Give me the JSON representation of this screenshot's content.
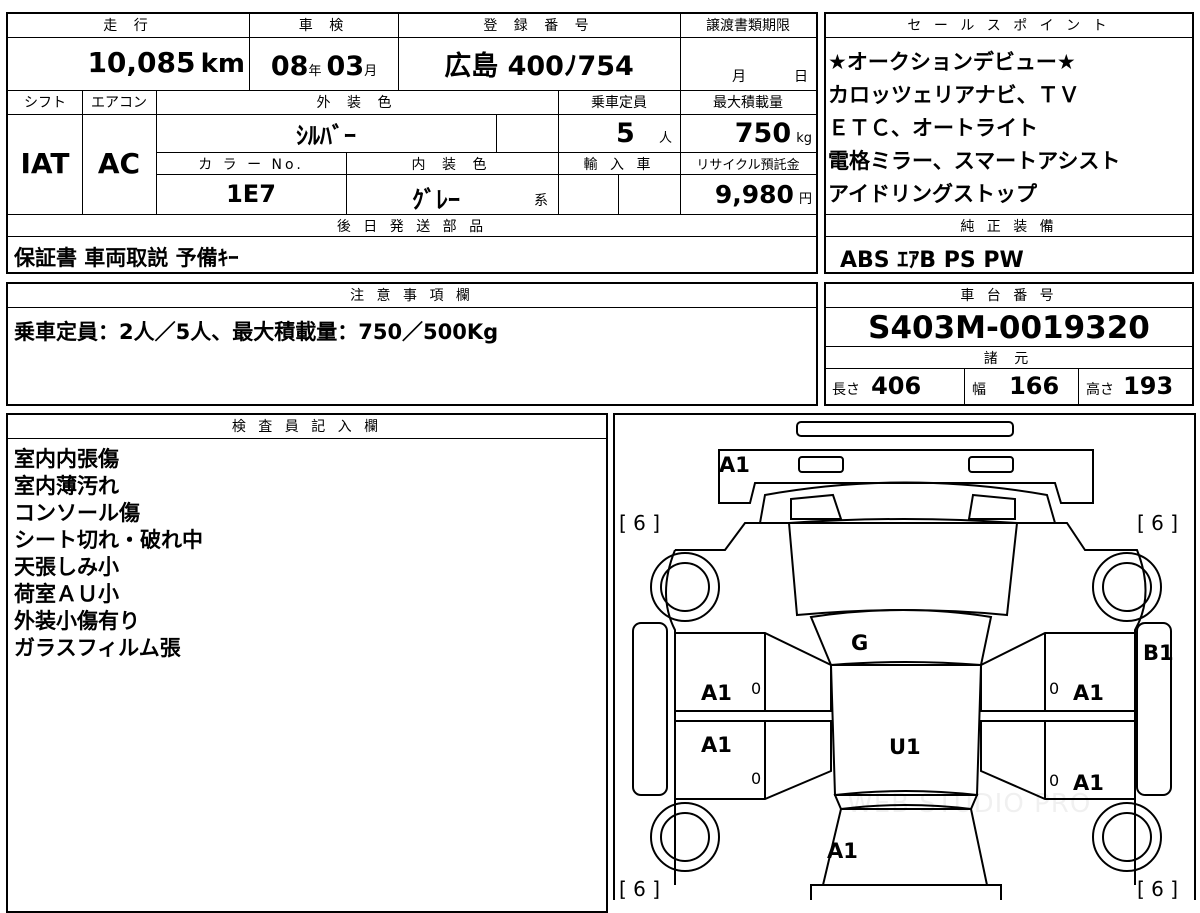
{
  "top_row": {
    "mileage_label": "走 行",
    "mileage_value": "10,085",
    "mileage_unit": "km",
    "inspection_label": "車 検",
    "inspection_year": "08",
    "inspection_year_unit": "年",
    "inspection_month": "03",
    "inspection_month_unit": "月",
    "registration_label": "登 録 番 号",
    "registration_value": "広島 400ﾉ754",
    "transfer_label": "譲渡書類期限",
    "transfer_month": "月",
    "transfer_day": "日"
  },
  "second_row": {
    "shift_label": "シフト",
    "shift_value": "IAT",
    "ac_label": "エアコン",
    "ac_value": "AC",
    "exterior_color_label": "外 装 色",
    "exterior_color_value": "ｼﾙﾊﾞｰ",
    "capacity_label": "乗車定員",
    "capacity_value": "5",
    "capacity_unit": "人",
    "max_load_label": "最大積載量",
    "max_load_value": "750",
    "max_load_unit": "kg",
    "color_no_label": "カ ラ ー No.",
    "color_no_value": "1E7",
    "interior_color_label": "内 装 色",
    "interior_color_value": "ｸﾞﾚｰ",
    "interior_color_suffix": "系",
    "import_label": "輸 入 車",
    "recycle_label": "リサイクル預託金",
    "recycle_value": "9,980",
    "recycle_unit": "円"
  },
  "later_parts": {
    "label": "後 日 発 送 部 品",
    "value": "保証書 車両取説 予備ｷｰ"
  },
  "sales_points": {
    "label": "セ ー ル ス ポ イ ン ト",
    "lines": [
      "★オークションデビュー★",
      "カロッツェリアナビ、ＴＶ",
      "ＥＴＣ、オートライト",
      "電格ミラー、スマートアシスト",
      "アイドリングストップ"
    ]
  },
  "standard_equipment": {
    "label": "純 正 装 備",
    "value": "ABS ｴｱB PS PW"
  },
  "notes": {
    "label": "注 意 事 項 欄",
    "value": "乗車定員：2人／5人、最大積載量：750／500Kg"
  },
  "chassis": {
    "label": "車 台 番 号",
    "value": "S403M-0019320"
  },
  "specs": {
    "label": "諸 元",
    "length_label": "長さ",
    "length_value": "406",
    "width_label": "幅",
    "width_value": "166",
    "height_label": "高さ",
    "height_value": "193"
  },
  "inspector": {
    "label": "検 査 員 記 入 欄",
    "lines": [
      "室内内張傷",
      "室内薄汚れ",
      "コンソール傷",
      "シート切れ・破れ中",
      "天張しみ小",
      "荷室ＡＵ小",
      "外装小傷有り",
      "ガラスフィルム張"
    ]
  },
  "diagram": {
    "tire_tl": "[ 6 ]",
    "tire_tr": "[ 6 ]",
    "tire_bl": "[ 6 ]",
    "tire_br": "[ 6 ]",
    "front_bumper": "A1",
    "windshield": "G",
    "roof": "U1",
    "left_front_door": "A1",
    "left_front_door_count": "0",
    "left_rear_door": "A1",
    "left_rear_door_count": "0",
    "right_front_door": "A1",
    "right_front_door_count": "0",
    "right_rear_door": "A1",
    "right_rear_door_count": "0",
    "right_side": "B1",
    "rear": "A1",
    "watermark": "WEB STUDIO PRO"
  }
}
